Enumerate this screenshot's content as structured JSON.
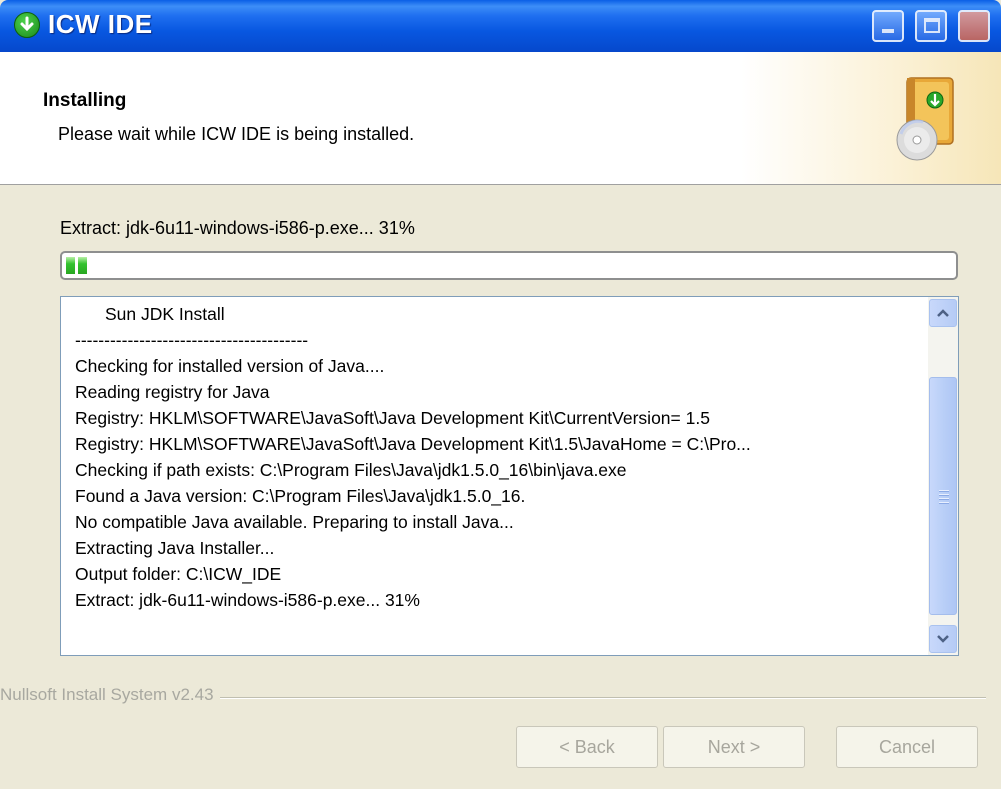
{
  "window": {
    "title": "ICW IDE",
    "title_icon": "download-arrow-icon"
  },
  "header": {
    "title": "Installing",
    "subtitle": "Please wait while ICW IDE is being installed.",
    "icon": "installer-box-cd-icon"
  },
  "progress": {
    "label": "Extract: jdk-6u11-windows-i586-p.exe... 31%",
    "value_percent": 31
  },
  "log": {
    "lines": [
      "Sun JDK Install",
      "----------------------------------------",
      "Checking for installed version of Java....",
      "Reading registry for Java",
      "Registry: HKLM\\SOFTWARE\\JavaSoft\\Java Development Kit\\CurrentVersion= 1.5",
      "Registry: HKLM\\SOFTWARE\\JavaSoft\\Java Development Kit\\1.5\\JavaHome = C:\\Pro...",
      "Checking if path exists: C:\\Program Files\\Java\\jdk1.5.0_16\\bin\\java.exe",
      "Found a Java version: C:\\Program Files\\Java\\jdk1.5.0_16.",
      "No compatible Java available. Preparing to install Java...",
      "Extracting Java Installer...",
      "Output folder: C:\\ICW_IDE",
      "Extract: jdk-6u11-windows-i586-p.exe... 31%"
    ]
  },
  "footer": {
    "branding": "Nullsoft Install System v2.43",
    "buttons": {
      "back": "< Back",
      "next": "Next >",
      "cancel": "Cancel"
    }
  }
}
